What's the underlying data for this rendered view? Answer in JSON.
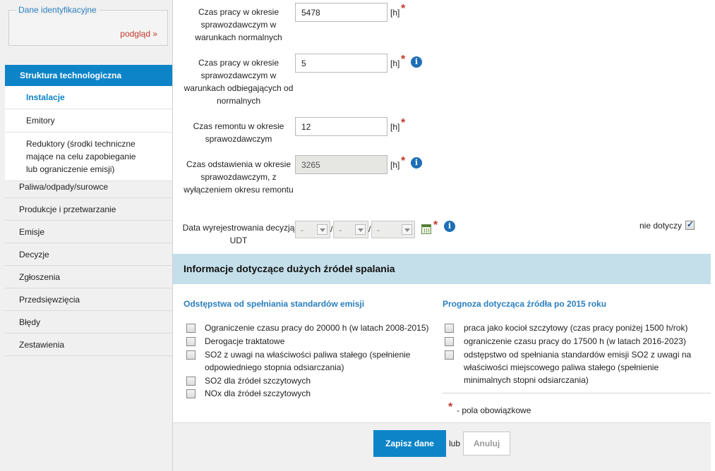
{
  "sidebar": {
    "id_box": {
      "title": "Dane identyfikacyjne",
      "link": "podgląd »"
    },
    "active_section": "Struktura technologiczna",
    "subitems": [
      {
        "label": "Instalacje",
        "active": true
      },
      {
        "label": "Emitory",
        "active": false
      },
      {
        "label": "Reduktory (środki techniczne mające na celu zapobieganie lub ograniczenie emisji)",
        "active": false
      }
    ],
    "items": [
      {
        "label": "Paliwa/odpady/surowce"
      },
      {
        "label": "Produkcje i przetwarzanie"
      },
      {
        "label": "Emisje"
      },
      {
        "label": "Decyzje"
      },
      {
        "label": "Zgłoszenia"
      },
      {
        "label": "Przedsięwzięcia"
      },
      {
        "label": "Błędy"
      },
      {
        "label": "Zestawienia"
      }
    ]
  },
  "form": {
    "fields": [
      {
        "label": "Czas pracy w okresie sprawozdawczym w warunkach normalnych",
        "value": "5478",
        "unit": "[h]",
        "required": "*",
        "info": false,
        "disabled": false
      },
      {
        "label": "Czas pracy w okresie sprawozdawczym w warunkach odbiegających od normalnych",
        "value": "5",
        "unit": "[h]",
        "required": "*",
        "info": true,
        "disabled": false
      },
      {
        "label": "Czas remontu w okresie sprawozdawczym",
        "value": "12",
        "unit": "[h]",
        "required": "*",
        "info": false,
        "disabled": false
      },
      {
        "label": "Czas odstawienia w okresie sprawozdawczym, z wyłączeniem okresu remontu",
        "value": "3265",
        "unit": "[h]",
        "required": "*",
        "info": true,
        "disabled": true
      }
    ],
    "date_field": {
      "label": "Data wyrejestrowania decyzją UDT",
      "day": "-",
      "month": "-",
      "year": "-",
      "separator": "/",
      "required": "*",
      "not_applicable_label": "nie dotyczy",
      "not_applicable_checked": true
    }
  },
  "lcp_section": {
    "title": "Informacje dotyczące dużych źródeł spalania",
    "left": {
      "heading": "Odstępstwa od spełniania standardów emisji",
      "options": [
        "Ograniczenie czasu pracy do 20000 h (w latach 2008-2015)",
        "Derogacje traktatowe",
        "SO2 z uwagi na właściwości paliwa stałego (spełnienie odpowiedniego stopnia odsiarczania)",
        "SO2 dla źródeł szczytowych",
        "NOx dla źródeł szczytowych"
      ]
    },
    "right": {
      "heading": "Prognoza dotycząca źródła po 2015 roku",
      "options": [
        "praca jako kocioł szczytowy (czas pracy poniżej 1500 h/rok)",
        "ograniczenie czasu pracy do 17500 h (w latach 2016-2023)",
        "odstępstwo od spełniania standardów emisji SO2 z uwagi na właściwości miejscowego paliwa stałego (spełnienie minimalnych stopni odsiarczania)"
      ]
    },
    "required_note_mark": "*",
    "required_note": "- pola obowiązkowe"
  },
  "actions": {
    "save": "Zapisz dane",
    "or": "lub",
    "cancel": "Anuluj"
  },
  "colors": {
    "accent": "#0d84c8",
    "required": "#c0392b",
    "section_bg": "#c4dfea"
  }
}
